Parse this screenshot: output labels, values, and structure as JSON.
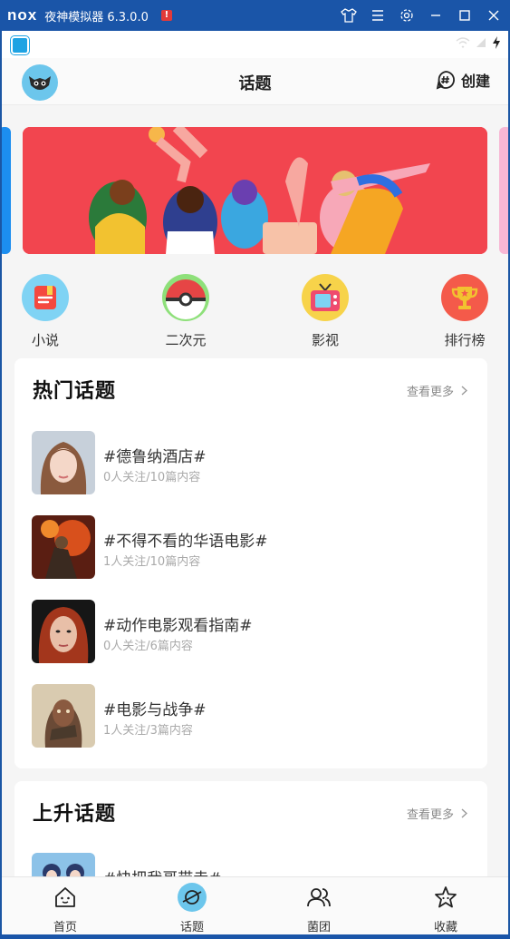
{
  "emulator": {
    "logo": "nox",
    "title": "夜神模拟器 6.3.0.0",
    "controls": [
      "shirt-icon",
      "menu-icon",
      "settings-icon",
      "minimize-icon",
      "maximize-icon",
      "close-icon"
    ]
  },
  "header": {
    "title": "话题",
    "create_label": "创建"
  },
  "categories": [
    {
      "label": "小说",
      "icon": "book-icon",
      "color": "#f4493f",
      "bg": "#7fd3f4"
    },
    {
      "label": "二次元",
      "icon": "pokeball-icon",
      "color": "#e64545",
      "bg": "#8ee07a"
    },
    {
      "label": "影视",
      "icon": "tv-icon",
      "color": "#ef4b6e",
      "bg": "#f7d34a"
    },
    {
      "label": "排行榜",
      "icon": "trophy-icon",
      "color": "#f2c230",
      "bg": "#f45a4a"
    }
  ],
  "hot_topics": {
    "title": "热门话题",
    "more_label": "查看更多",
    "items": [
      {
        "name": "#德鲁纳酒店#",
        "meta": "0人关注/10篇内容"
      },
      {
        "name": "#不得不看的华语电影#",
        "meta": "1人关注/10篇内容"
      },
      {
        "name": "#动作电影观看指南#",
        "meta": "0人关注/6篇内容"
      },
      {
        "name": "#电影与战争#",
        "meta": "1人关注/3篇内容"
      }
    ]
  },
  "rising_topics": {
    "title": "上升话题",
    "more_label": "查看更多",
    "items": [
      {
        "name": "#快把我哥带走#",
        "meta": ""
      }
    ]
  },
  "bottom_nav": [
    {
      "label": "首页",
      "icon": "home-icon"
    },
    {
      "label": "话题",
      "icon": "topic-planet-icon"
    },
    {
      "label": "菌团",
      "icon": "group-icon"
    },
    {
      "label": "收藏",
      "icon": "star-icon"
    }
  ],
  "colors": {
    "accent_blue": "#6cc6ec",
    "banner_red": "#f2454f",
    "emulator_blue": "#1a55a8"
  }
}
